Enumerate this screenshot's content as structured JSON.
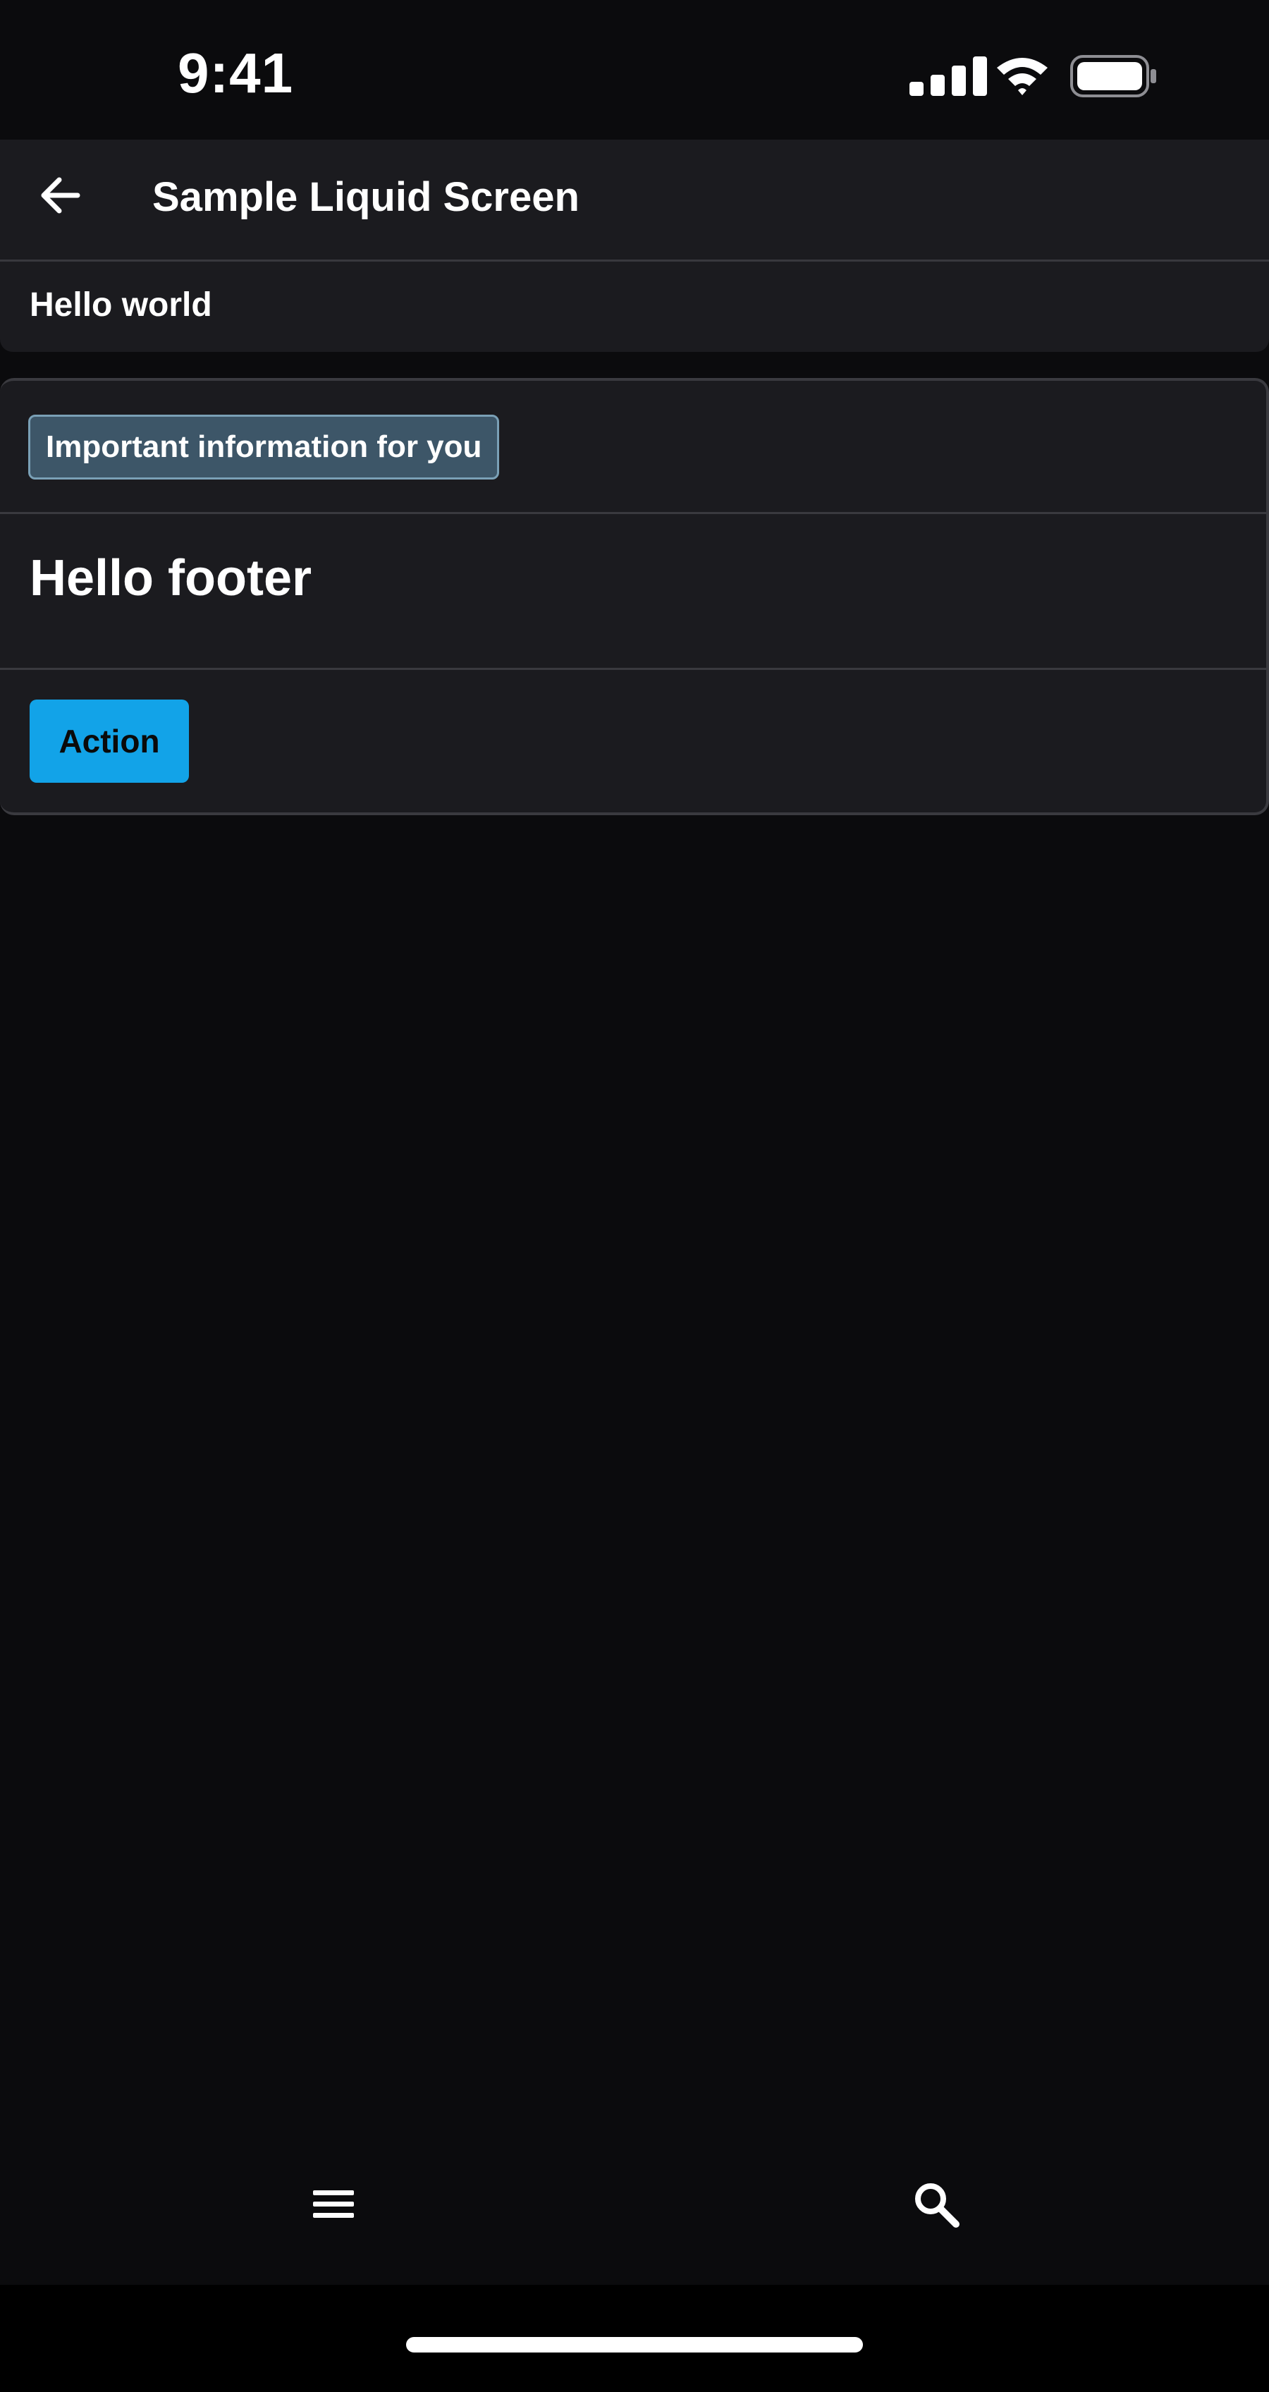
{
  "status_bar": {
    "time": "9:41",
    "icons": [
      "cellular-signal-icon",
      "wifi-icon",
      "battery-icon"
    ]
  },
  "header": {
    "back_icon": "arrow-left-icon",
    "title": "Sample Liquid Screen"
  },
  "hello_bar": {
    "text": "Hello world"
  },
  "card": {
    "chip_label": "Important information for you",
    "footer_heading": "Hello footer",
    "action_label": "Action"
  },
  "bottom_nav": {
    "items": [
      "menu-icon",
      "search-icon"
    ]
  },
  "colors": {
    "background": "#0b0b0d",
    "surface": "#1b1b1f",
    "accent": "#12a3e8",
    "chip_bg": "#3d5668",
    "chip_border": "#7aa0b6"
  }
}
